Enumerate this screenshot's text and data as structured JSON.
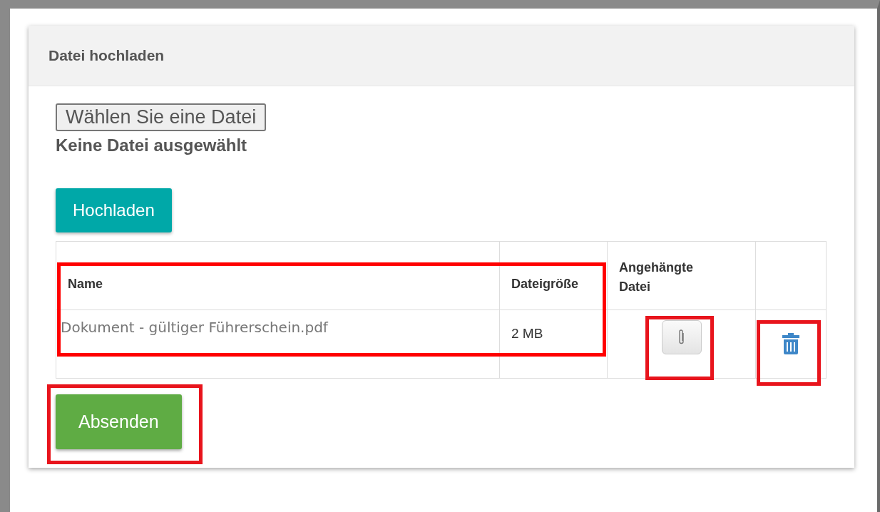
{
  "panel": {
    "title": "Datei hochladen"
  },
  "file_input": {
    "button": "Wählen Sie eine Datei",
    "status": "Keine Datei ausgewählt"
  },
  "upload_button": "Hochladen",
  "table": {
    "columns": [
      "Name",
      "Dateigröße",
      "Angehängte Datei"
    ],
    "rows": [
      {
        "name": "Dokument - gültiger Führerschein.pdf",
        "size": "2 MB"
      }
    ]
  },
  "submit_button": "Absenden",
  "highlights": {
    "file_info": true,
    "attachment": true,
    "delete": true,
    "submit": true
  }
}
